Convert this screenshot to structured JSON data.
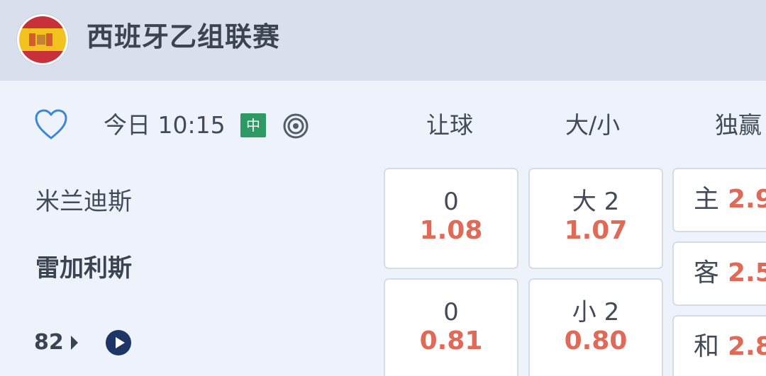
{
  "league": {
    "name": "西班牙乙组联赛",
    "flag_colors": {
      "red": "#c8303a",
      "yellow": "#f4c21f"
    }
  },
  "match": {
    "time": "今日 10:15",
    "live_badge": "中",
    "home_team": "米兰迪斯",
    "away_team": "雷加利斯",
    "minute": "82"
  },
  "columns": {
    "handicap": "让球",
    "over_under": "大/小",
    "moneyline": "独赢"
  },
  "handicap": [
    {
      "line": "0",
      "odds": "1.08"
    },
    {
      "line": "0",
      "odds": "0.81"
    }
  ],
  "over_under": [
    {
      "line": "大 2",
      "odds": "1.07"
    },
    {
      "line": "小 2",
      "odds": "0.80"
    }
  ],
  "moneyline": [
    {
      "label": "主",
      "odds": "2.9"
    },
    {
      "label": "客",
      "odds": "2.5"
    },
    {
      "label": "和",
      "odds": "2.8"
    }
  ],
  "colors": {
    "odds_red": "#e06a57",
    "header_bg": "#d9dfec",
    "icon_blue": "#3a86d9",
    "live_green": "#2e9a63",
    "play_navy": "#1f3566"
  }
}
